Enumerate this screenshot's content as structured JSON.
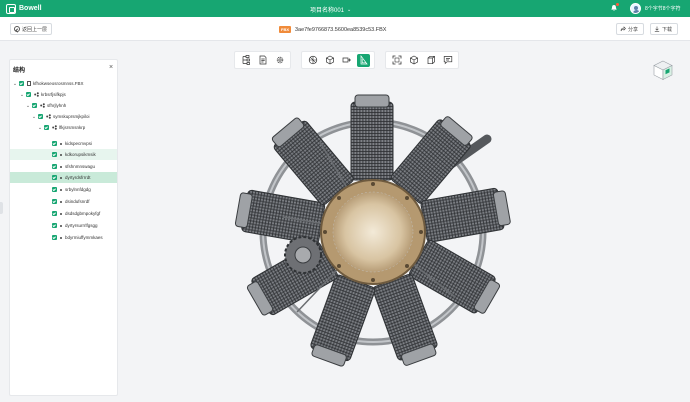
{
  "app": {
    "brand": "Bowell",
    "project_name": "项目名称001",
    "username": "8个字节8个字符"
  },
  "subbar": {
    "back_label": "返回上一层",
    "file_badge": "FBX",
    "file_name": "3ae7fe9766873.5600ea8539c53.FBX",
    "share_label": "分享",
    "download_label": "下载"
  },
  "panel": {
    "title": "结构",
    "tree": [
      {
        "label": "kfhokwseosrosmnss.FBX"
      },
      {
        "label": "krbsrfjsifkpjs"
      },
      {
        "label": "sfhrjlyhnh"
      },
      {
        "label": "symskuprsmjkpiloi"
      },
      {
        "label": "lfkjsrsmsnkrp"
      },
      {
        "label": "kidspecmvpsi"
      },
      {
        "label": "kdkorupsikmsik"
      },
      {
        "label": "sfshnmnswagu"
      },
      {
        "label": "dyrtyrdsfrrrdt"
      },
      {
        "label": "srbylnnfdgdg"
      },
      {
        "label": "dsindufsnrdf"
      },
      {
        "label": "dsdsdgbmpokyfgf"
      },
      {
        "label": "dyrtyrsurrrlfgsgg"
      },
      {
        "label": "bdyrmiuffymmkaes"
      }
    ]
  },
  "toolbar": {
    "groups": [
      [
        "tree-icon",
        "document-icon",
        "gear-icon"
      ],
      [
        "explode-icon",
        "cube-icon",
        "section-plane-icon",
        "measure-icon"
      ],
      [
        "fullscreen-icon",
        "view-cube-icon",
        "box-icon",
        "comment-icon"
      ]
    ],
    "active": "measure-icon"
  },
  "colors": {
    "brand": "#17a672",
    "badge": "#f08b3a",
    "selected_row": "#c9ead9",
    "hover_row": "#e7f5ee"
  }
}
